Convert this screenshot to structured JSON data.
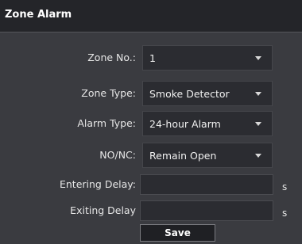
{
  "window": {
    "title": "Zone Alarm"
  },
  "form": {
    "zone_no": {
      "label": "Zone No.:",
      "value": "1"
    },
    "zone_type": {
      "label": "Zone Type:",
      "value": "Smoke Detector"
    },
    "alarm_type": {
      "label": "Alarm Type:",
      "value": "24-hour Alarm"
    },
    "no_nc": {
      "label": "NO/NC:",
      "value": "Remain Open"
    },
    "entering_delay": {
      "label": "Entering Delay:",
      "value": "",
      "unit": "s"
    },
    "exiting_delay": {
      "label": "Exiting Delay",
      "value": "",
      "unit": "s"
    }
  },
  "actions": {
    "save_label": "Save"
  },
  "colors": {
    "panel_background": "#3a3b40",
    "titlebar_background": "#242529",
    "field_background": "#2b2c31",
    "text": "#e6e6e6"
  },
  "icons": {
    "dropdown": "caret-down-icon"
  }
}
